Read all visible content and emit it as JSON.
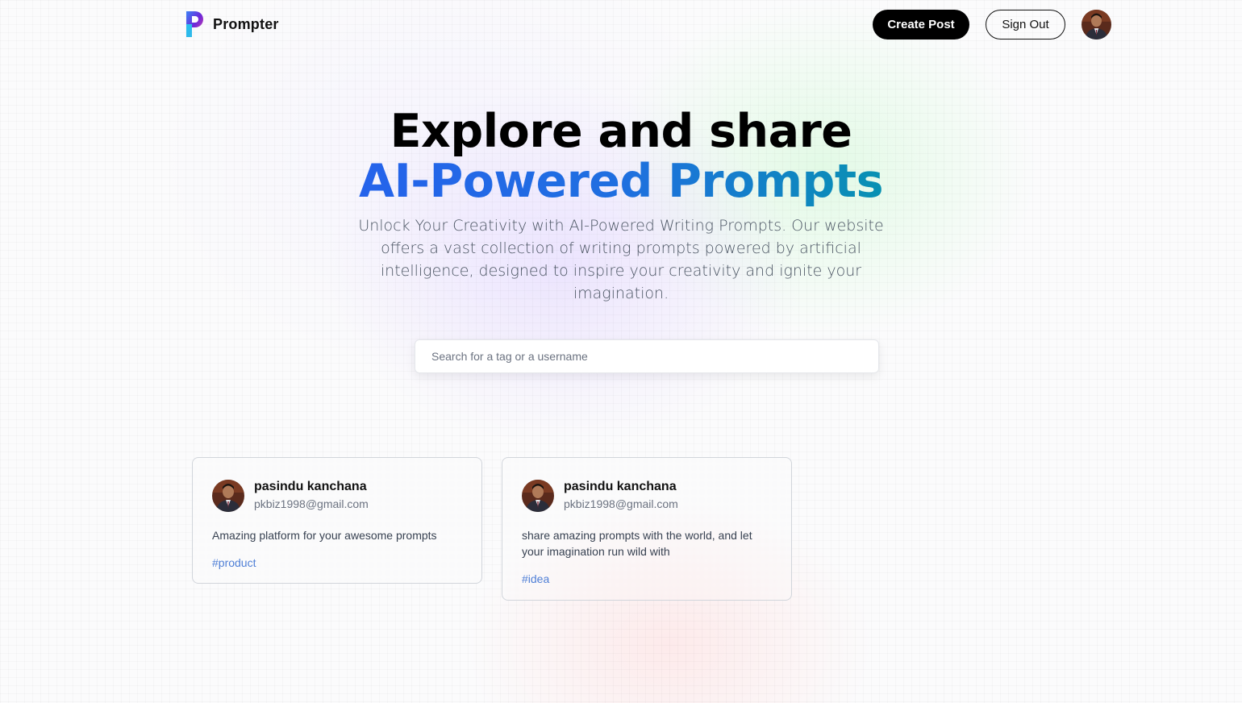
{
  "brand": {
    "name": "Prompter",
    "logo_icon": "prompter-logo-icon"
  },
  "nav": {
    "create_label": "Create Post",
    "signout_label": "Sign Out",
    "avatar_icon": "user-avatar"
  },
  "hero": {
    "title_line1": "Explore and share",
    "title_line2": "AI-Powered Prompts",
    "description": "Unlock Your Creativity with AI-Powered Writing Prompts. Our website offers a vast collection of writing prompts powered by artificial intelligence, designed to inspire your creativity and ignite your imagination."
  },
  "search": {
    "placeholder": "Search for a tag or a username",
    "value": ""
  },
  "posts": [
    {
      "username": "pasindu kanchana",
      "email": "pkbiz1998@gmail.com",
      "prompt": "Amazing platform for your awesome prompts",
      "tag": "#product"
    },
    {
      "username": "pasindu kanchana",
      "email": "pkbiz1998@gmail.com",
      "prompt": "share amazing prompts with the world, and let your imagination run wild with",
      "tag": "#idea"
    }
  ],
  "colors": {
    "gradient_start": "#2563eb",
    "gradient_end": "#0891b2",
    "tag": "#4f7fd6",
    "button": "#000000"
  }
}
